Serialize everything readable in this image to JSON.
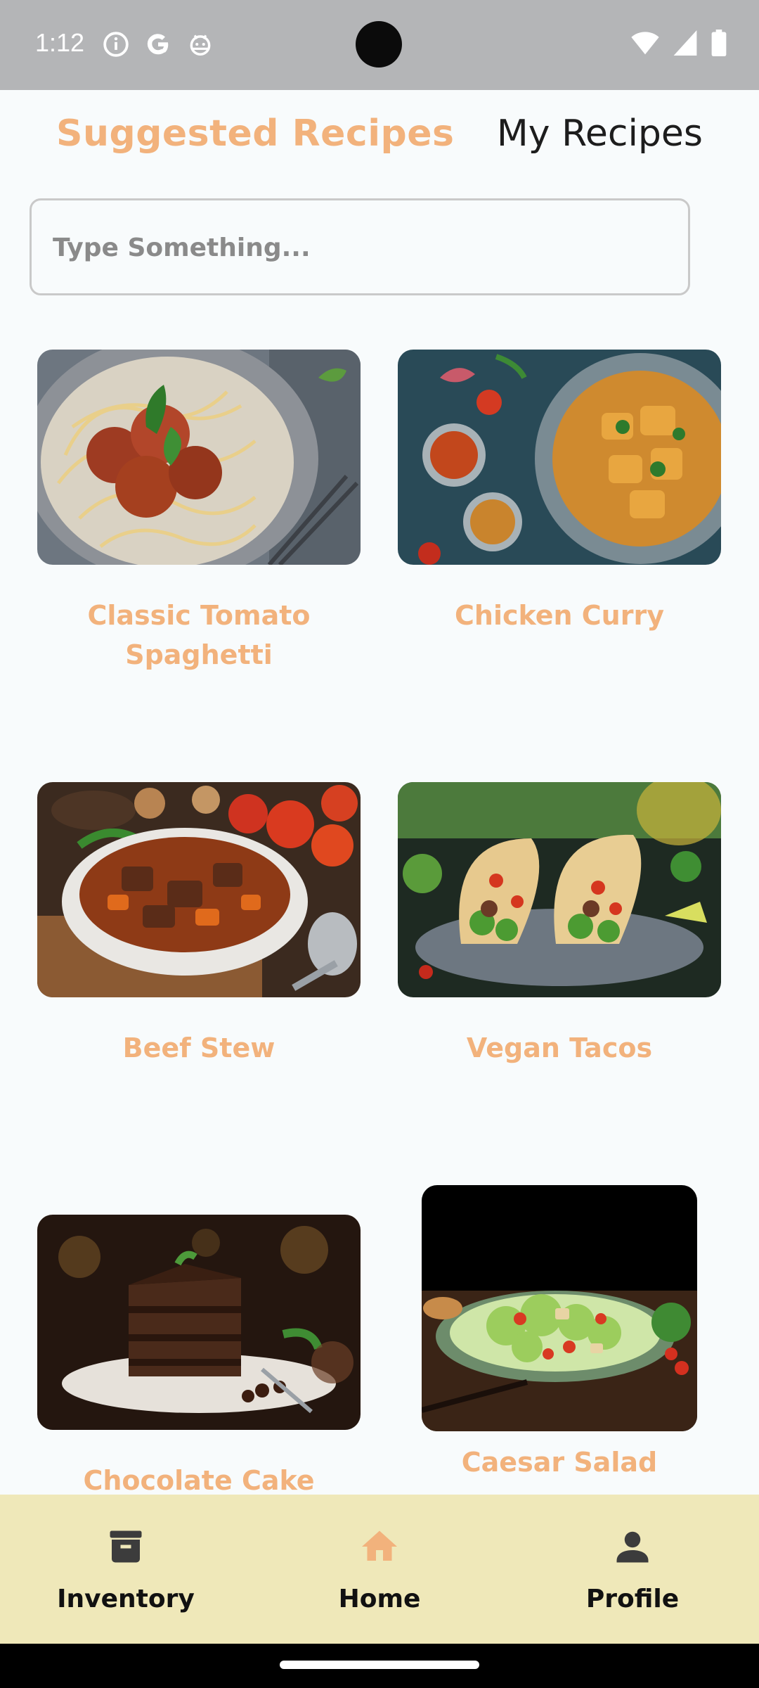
{
  "status_bar": {
    "time": "1:12"
  },
  "tabs": {
    "suggested": "Suggested Recipes",
    "mine": "My Recipes"
  },
  "search": {
    "placeholder": "Type Something..."
  },
  "recipes": [
    {
      "title": "Classic Tomato Spaghetti"
    },
    {
      "title": "Chicken Curry"
    },
    {
      "title": "Beef Stew"
    },
    {
      "title": "Vegan Tacos"
    },
    {
      "title": "Chocolate Cake"
    },
    {
      "title": "Caesar Salad"
    }
  ],
  "nav": {
    "inventory": "Inventory",
    "home": "Home",
    "profile": "Profile"
  },
  "colors": {
    "accent": "#f2b27c",
    "nav_bg": "#efe8b9",
    "status_bg": "#b4b5b7"
  },
  "icons": {
    "status_left": [
      "info-icon",
      "google-icon",
      "android-icon"
    ],
    "status_right": [
      "wifi-icon",
      "signal-icon",
      "battery-icon"
    ],
    "nav": [
      "archive-icon",
      "home-icon",
      "person-icon"
    ]
  }
}
